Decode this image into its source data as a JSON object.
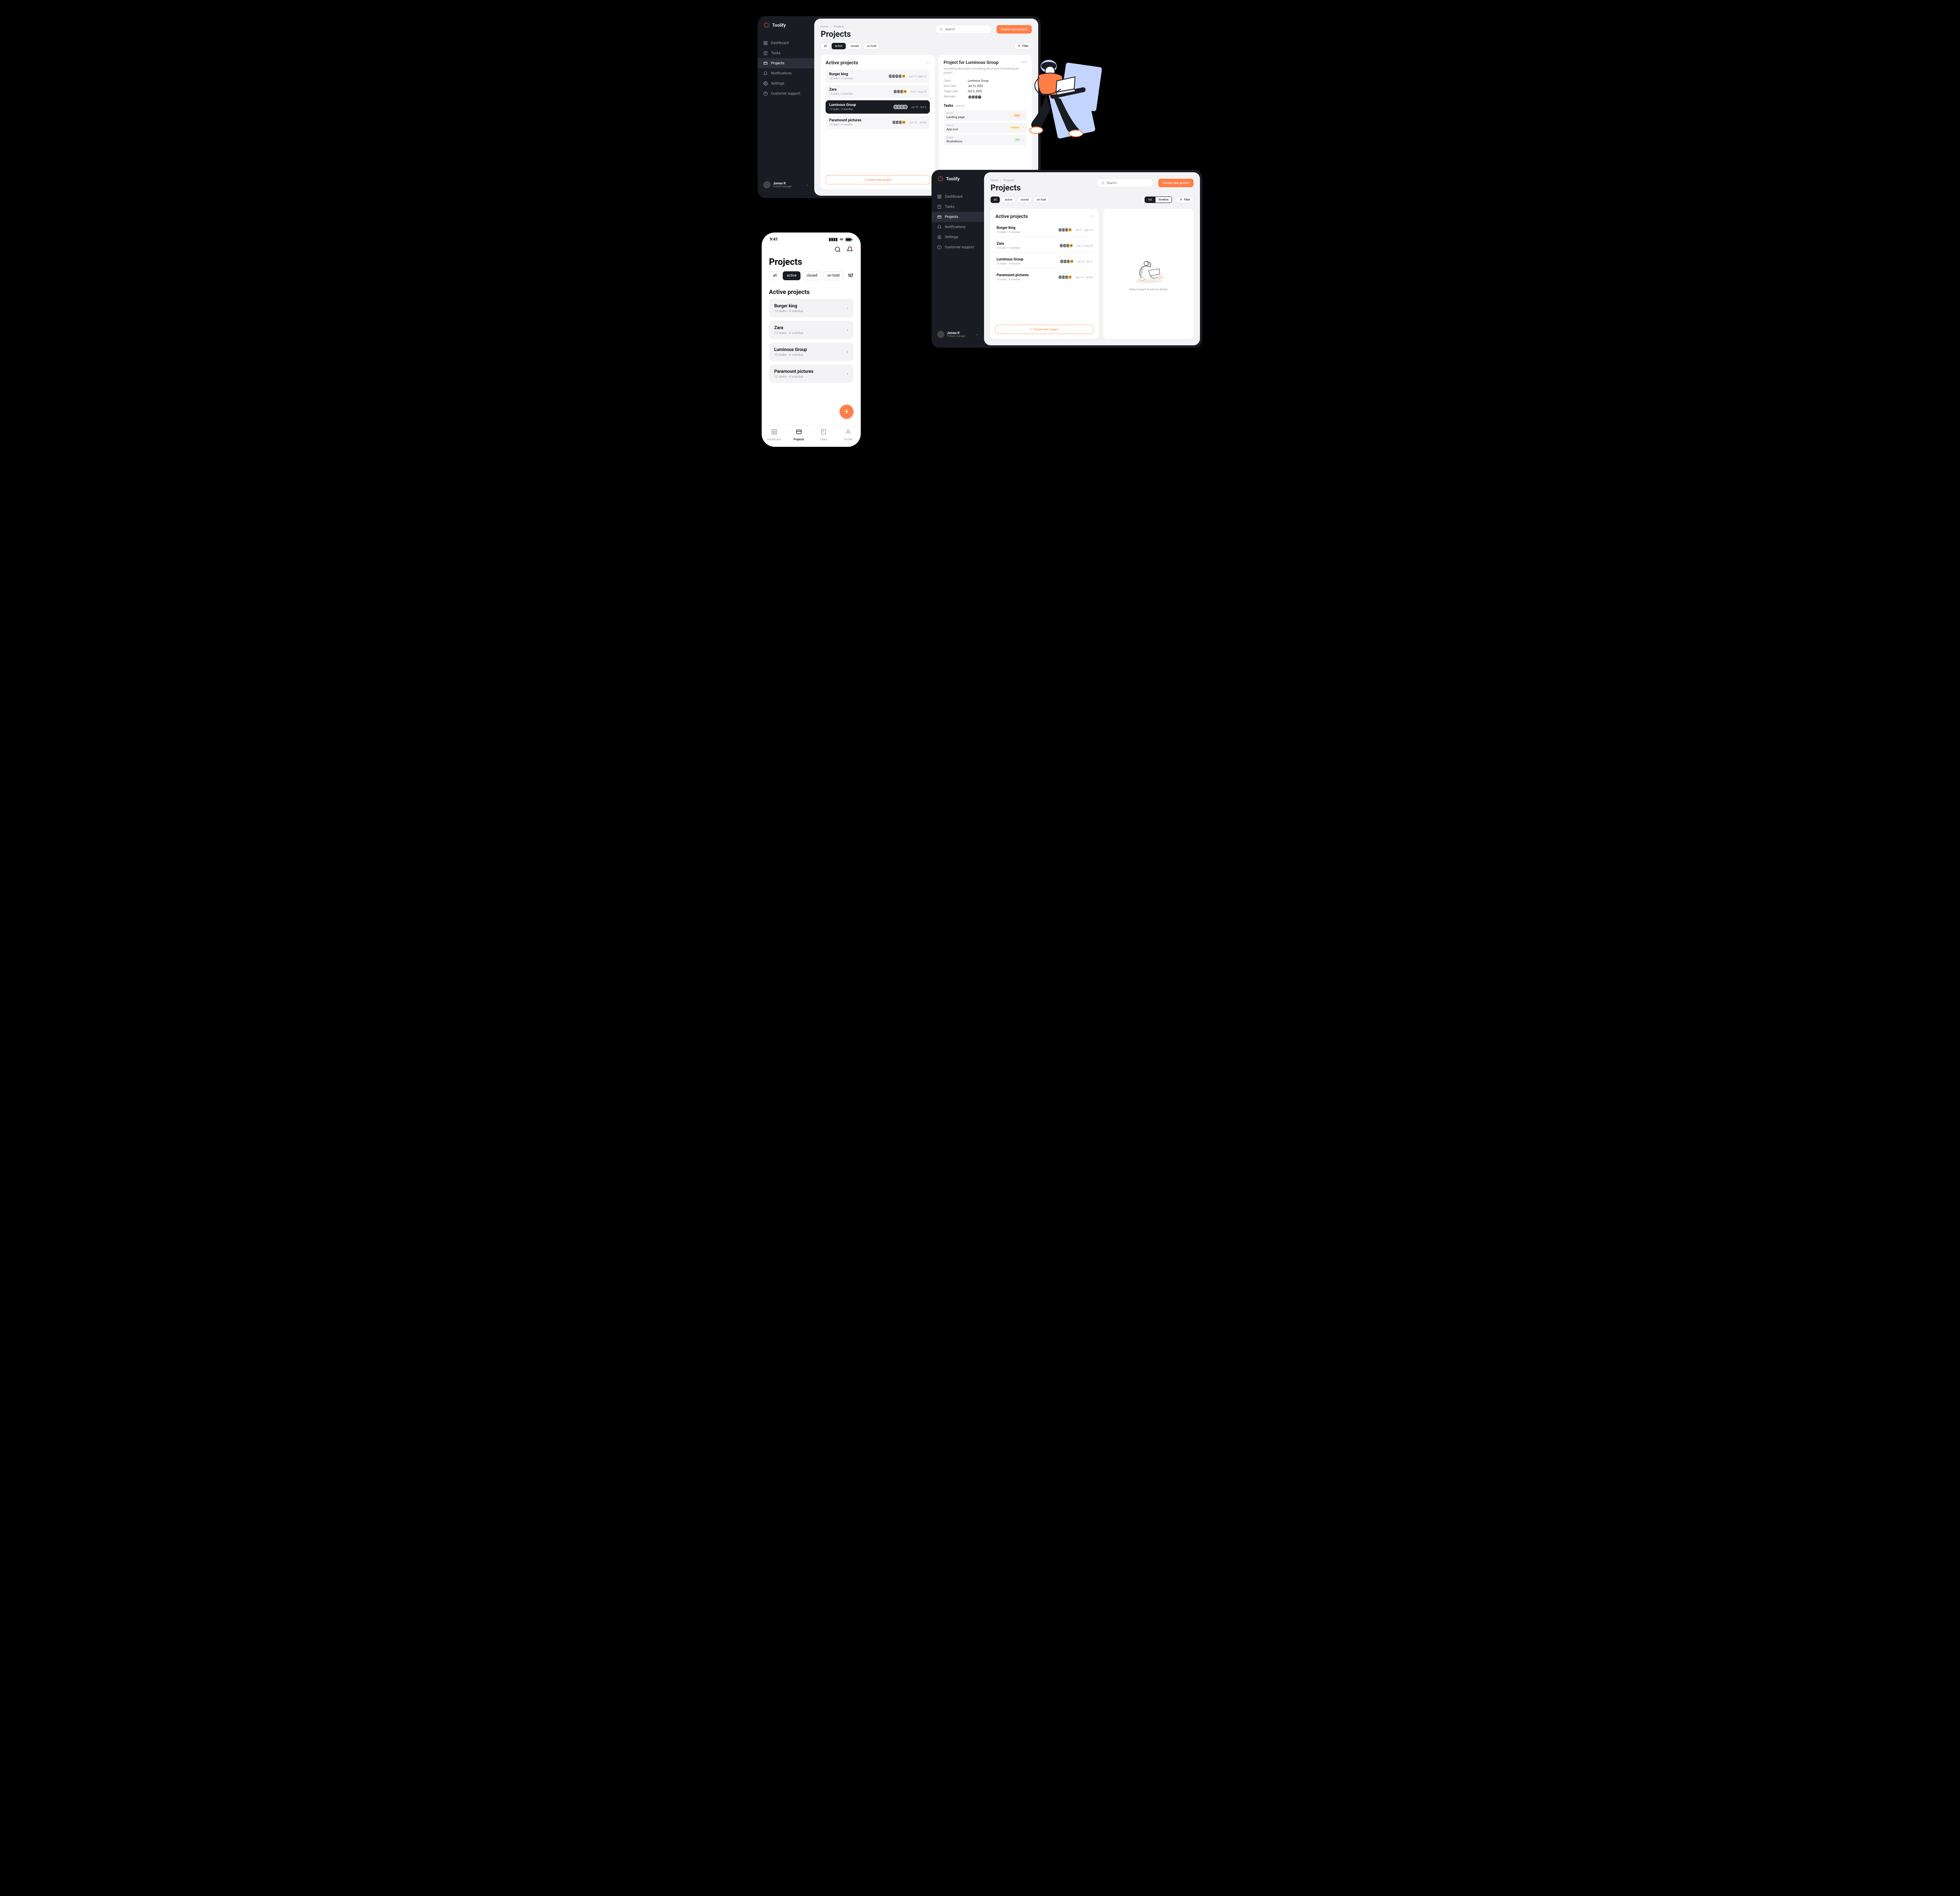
{
  "brand": "Toolify",
  "breadcrumb": {
    "home": "Home",
    "projects": "Projects"
  },
  "page_title": "Projects",
  "search": {
    "placeholder": "Search"
  },
  "buttons": {
    "create": "Create new project",
    "create_plus": "+  Create new project",
    "filter": "Filter"
  },
  "tabs": [
    "all",
    "active",
    "closed",
    "on hold"
  ],
  "view_modes": [
    "list",
    "timeline"
  ],
  "nav": [
    {
      "label": "Dashboard"
    },
    {
      "label": "Tasks"
    },
    {
      "label": "Projects"
    },
    {
      "label": "Notifications"
    },
    {
      "label": "Settings"
    },
    {
      "label": "Customer support"
    }
  ],
  "user": {
    "name": "James R",
    "role": "Product manager"
  },
  "section": {
    "active_projects": "Active projects"
  },
  "projects": [
    {
      "name": "Burger king",
      "meta": "13 tasks  •  4 overdue",
      "dates": "Jul 17 - Sep 14",
      "extra": "+3"
    },
    {
      "name": "Zara",
      "meta": "13 tasks  •  4 overdue",
      "dates": "Jul 2 - Aug 18",
      "extra": "+4"
    },
    {
      "name": "Luminous Group",
      "meta": "13 tasks  •  4 overdue",
      "dates": "Jul 13 - Oct 2",
      "extra": ""
    },
    {
      "name": "Paramount pictures",
      "meta": "13 tasks  •  4 overdue",
      "dates": "Jun 12 - Jul 24",
      "extra": "+2"
    }
  ],
  "detail": {
    "title": "Project for Luminous Group",
    "desc": "Something abt project something abt project Something abt project",
    "fields": {
      "client_l": "Client",
      "client_v": "Luminous Group",
      "start_l": "Start date",
      "start_v": "Jul 13, 2022",
      "target_l": "Target date",
      "target_v": "Oct 2, 2022",
      "members_l": "Members"
    },
    "tasks_title": "Tasks",
    "viewall": "view all",
    "tasks": [
      {
        "id": "ID LG-1",
        "name": "Landing page",
        "prio": "high"
      },
      {
        "id": "ID LG-2",
        "name": "App icon",
        "prio": "medium"
      },
      {
        "id": "ID LG-3",
        "name": "Illustrations",
        "prio": "low"
      }
    ]
  },
  "empty": {
    "text": "Select project to see it's details"
  },
  "projects_s2_extra": [
    "+3",
    "+4",
    "+4",
    "+7"
  ],
  "mobile": {
    "time": "9:41",
    "title": "Projects",
    "bottomnav": [
      "Dashboard",
      "Projects",
      "Tasks",
      "Profile"
    ]
  }
}
